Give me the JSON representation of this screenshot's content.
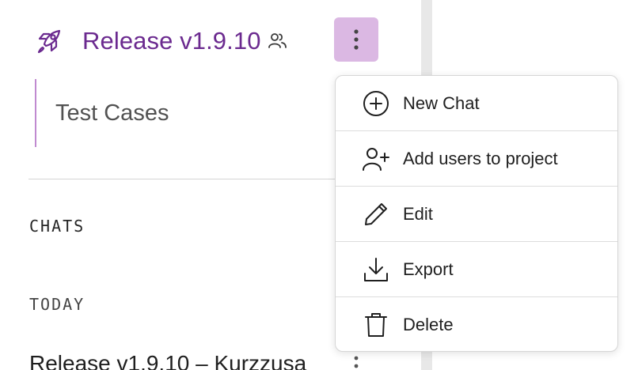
{
  "project": {
    "title": "Release v1.9.10",
    "icon": "rocket-icon",
    "shared_icon": "users-icon",
    "accent_color": "#6b2a8f",
    "kebab_active_color": "#dbb8e3"
  },
  "project_items": [
    {
      "label": "Test Cases"
    }
  ],
  "sections": {
    "chats_heading": "CHATS",
    "today_heading": "TODAY"
  },
  "chats": [
    {
      "title": "Release v1.9.10 – Kurzzusa"
    }
  ],
  "menu": {
    "items": [
      {
        "label": "New Chat",
        "icon": "plus-circle-icon"
      },
      {
        "label": "Add users to project",
        "icon": "add-user-icon"
      },
      {
        "label": "Edit",
        "icon": "pencil-icon"
      },
      {
        "label": "Export",
        "icon": "download-icon"
      },
      {
        "label": "Delete",
        "icon": "trash-icon"
      }
    ]
  }
}
